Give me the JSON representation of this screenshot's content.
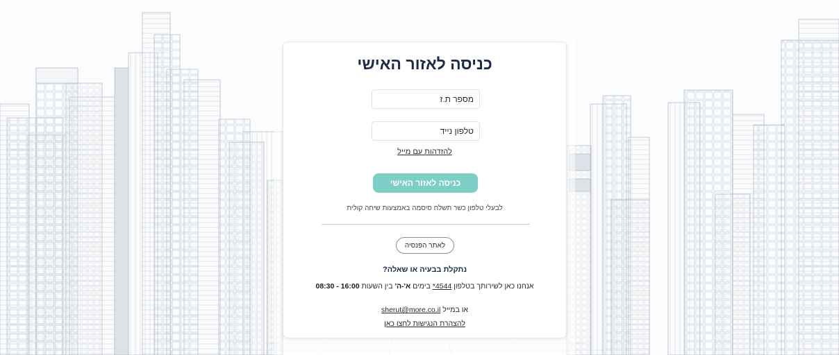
{
  "login": {
    "title": "כניסה לאזור האישי",
    "id_placeholder": "מספר ת.ז",
    "phone_placeholder": "טלפון נייד",
    "email_login_link": "להזדהות עם מייל",
    "submit_label": "כניסה לאזור האישי",
    "landline_note": "לבעלי טלפון כשר תשלח סיסמה באמצעות שיחה קולית",
    "pension_site_button": "לאתר הפנסיה"
  },
  "help": {
    "title": "נתקלת בבעיה או שאלה?",
    "line_prefix": "אנחנו כאן לשירותך בטלפון",
    "phone": "4544*",
    "line_days_prefix": "בימים",
    "days": "א'-ה'",
    "line_hours_prefix": "בין השעות",
    "hours": "08:30 - 16:00",
    "mail_prefix": "או במייל",
    "email": "sherut@more.co.il",
    "accessibility_link": "להצהרת הנגישות לחצו כאן"
  },
  "colors": {
    "primary_button": "#7ecdc6",
    "title": "#1c2a4a"
  }
}
